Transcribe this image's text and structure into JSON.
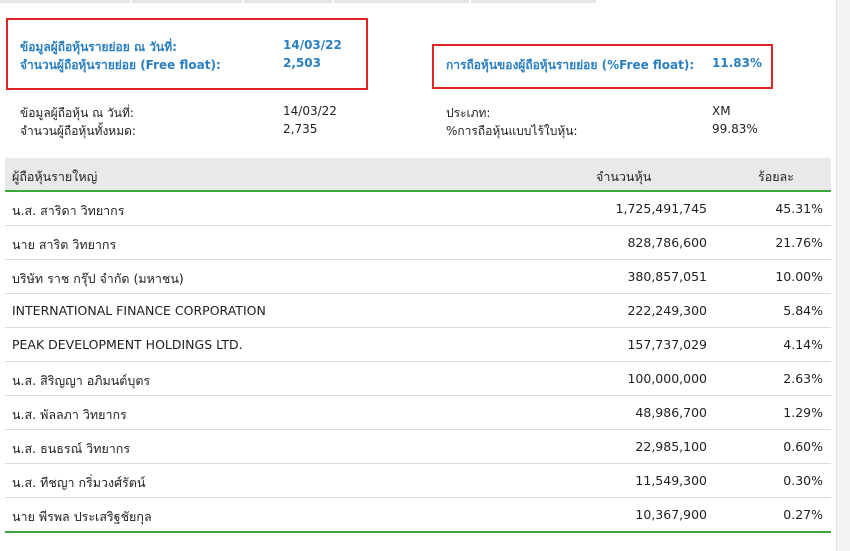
{
  "summary_highlighted": {
    "retail_data_date_label": "ข้อมูลผู้ถือหุ้นรายย่อย ณ วันที่:",
    "retail_data_date_value": "14/03/22",
    "retail_count_label": "จำนวนผู้ถือหุ้นรายย่อย (Free float):",
    "retail_count_value": "2,503",
    "retail_pct_label": "การถือหุ้นของผู้ถือหุ้นรายย่อย (%Free float):",
    "retail_pct_value": "11.83%"
  },
  "summary": {
    "data_date_label": "ข้อมูลผู้ถือหุ้น ณ วันที่:",
    "data_date_value": "14/03/22",
    "total_count_label": "จำนวนผู้ถือหุ้นทั้งหมด:",
    "total_count_value": "2,735",
    "type_label": "ประเภท:",
    "type_value": "XM",
    "scripless_label": "%การถือหุ้นแบบไร้ใบหุ้น:",
    "scripless_value": "99.83%"
  },
  "table": {
    "headers": {
      "name": "ผู้ถือหุ้นรายใหญ่",
      "shares": "จำนวนหุ้น",
      "pct": "ร้อยละ"
    },
    "rows": [
      {
        "name": "น.ส. สาริดา วิทยากร",
        "shares": "1,725,491,745",
        "pct": "45.31%"
      },
      {
        "name": "นาย สาริต วิทยากร",
        "shares": "828,786,600",
        "pct": "21.76%"
      },
      {
        "name": "บริษัท ราช กรุ๊ป จำกัด (มหาชน)",
        "shares": "380,857,051",
        "pct": "10.00%"
      },
      {
        "name": "INTERNATIONAL FINANCE CORPORATION",
        "shares": "222,249,300",
        "pct": "5.84%"
      },
      {
        "name": "PEAK DEVELOPMENT HOLDINGS LTD.",
        "shares": "157,737,029",
        "pct": "4.14%"
      },
      {
        "name": "น.ส. สิริญญา อภิมนต์บุตร",
        "shares": "100,000,000",
        "pct": "2.63%"
      },
      {
        "name": "น.ส. พัลลภา วิทยากร",
        "shares": "48,986,700",
        "pct": "1.29%"
      },
      {
        "name": "น.ส. ธนธรณ์ วิทยากร",
        "shares": "22,985,100",
        "pct": "0.60%"
      },
      {
        "name": "น.ส. ทีชญา กริ่มวงศ์รัตน์",
        "shares": "11,549,300",
        "pct": "0.30%"
      },
      {
        "name": "นาย พีรพล ประเสริฐชัยกุล",
        "shares": "10,367,900",
        "pct": "0.27%"
      }
    ]
  },
  "colors": {
    "highlight_border": "#e02424",
    "accent_text": "#2a7fc2",
    "table_rule": "#3aa83a"
  }
}
